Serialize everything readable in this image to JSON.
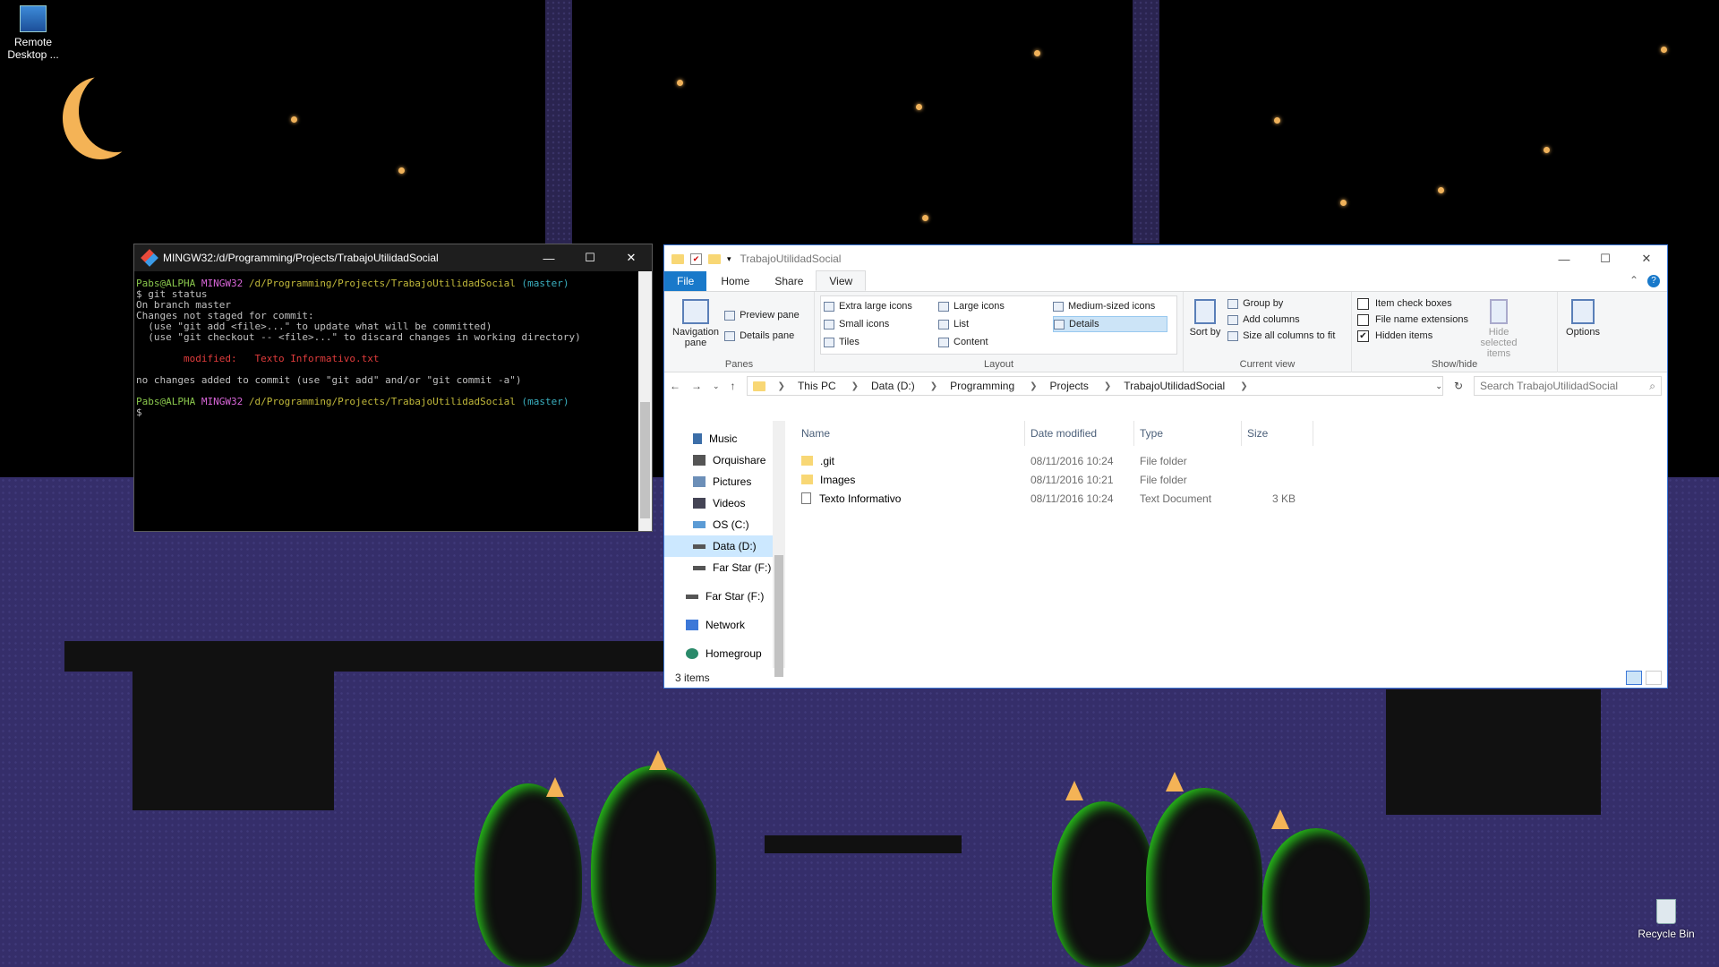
{
  "desktop": {
    "icons": [
      {
        "label": "Remote Desktop ...",
        "icon": "remote-desktop-icon"
      },
      {
        "label": "Recycle Bin",
        "icon": "recycle-bin-icon"
      }
    ],
    "colors": {
      "sky": "#000000",
      "floor": "#352e6a",
      "moon": "#f4b356",
      "glow": "#29c41c"
    }
  },
  "terminal": {
    "title": "MINGW32:/d/Programming/Projects/TrabajoUtilidadSocial",
    "prompt_user": "Pabs@ALPHA",
    "prompt_env": "MINGW32",
    "prompt_path": "/d/Programming/Projects/TrabajoUtilidadSocial",
    "prompt_branch": "(master)",
    "cmd": "$ git status",
    "out1": "On branch master",
    "out2": "Changes not staged for commit:",
    "out3": "  (use \"git add <file>...\" to update what will be committed)",
    "out4": "  (use \"git checkout -- <file>...\" to discard changes in working directory)",
    "mod_label": "        modified:   ",
    "mod_file": "Texto Informativo.txt",
    "out5": "no changes added to commit (use \"git add\" and/or \"git commit -a\")",
    "cursor": "$"
  },
  "explorer": {
    "title": "TrabajoUtilidadSocial",
    "tabs": [
      "File",
      "Home",
      "Share",
      "View"
    ],
    "active_tab": "View",
    "panes": {
      "label": "Panes",
      "nav": "Navigation pane",
      "preview": "Preview pane",
      "details": "Details pane"
    },
    "layout": {
      "label": "Layout",
      "items": [
        "Extra large icons",
        "Large icons",
        "Medium-sized icons",
        "Small icons",
        "List",
        "Details",
        "Tiles",
        "Content"
      ],
      "selected": "Details"
    },
    "current_view": {
      "label": "Current view",
      "sort": "Sort by",
      "group": "Group by",
      "add_columns": "Add columns",
      "size_all": "Size all columns to fit"
    },
    "show_hide": {
      "label": "Show/hide",
      "item_checkboxes": "Item check boxes",
      "item_checkboxes_checked": false,
      "ext": "File name extensions",
      "ext_checked": false,
      "hidden": "Hidden items",
      "hidden_checked": true,
      "hide_selected": "Hide selected items"
    },
    "options": "Options",
    "breadcrumb": [
      "This PC",
      "Data (D:)",
      "Programming",
      "Projects",
      "TrabajoUtilidadSocial"
    ],
    "search_placeholder": "Search TrabajoUtilidadSocial",
    "nav_items": [
      {
        "label": "Music",
        "icon": "music-icon"
      },
      {
        "label": "Orquishare",
        "icon": "cloud-icon"
      },
      {
        "label": "Pictures",
        "icon": "pictures-icon"
      },
      {
        "label": "Videos",
        "icon": "videos-icon"
      },
      {
        "label": "OS (C:)",
        "icon": "drive-icon"
      },
      {
        "label": "Data (D:)",
        "icon": "drive-icon",
        "selected": true
      },
      {
        "label": "Far Star (F:)",
        "icon": "drive-icon"
      },
      {
        "label": "Far Star (F:)",
        "icon": "drive-icon"
      },
      {
        "label": "Network",
        "icon": "network-icon"
      },
      {
        "label": "Homegroup",
        "icon": "homegroup-icon"
      }
    ],
    "columns": [
      "Name",
      "Date modified",
      "Type",
      "Size"
    ],
    "files": [
      {
        "name": ".git",
        "date": "08/11/2016 10:24",
        "type": "File folder",
        "size": "",
        "kind": "folder"
      },
      {
        "name": "Images",
        "date": "08/11/2016 10:21",
        "type": "File folder",
        "size": "",
        "kind": "folder"
      },
      {
        "name": "Texto Informativo",
        "date": "08/11/2016 10:24",
        "type": "Text Document",
        "size": "3 KB",
        "kind": "doc"
      }
    ],
    "status": "3 items"
  }
}
